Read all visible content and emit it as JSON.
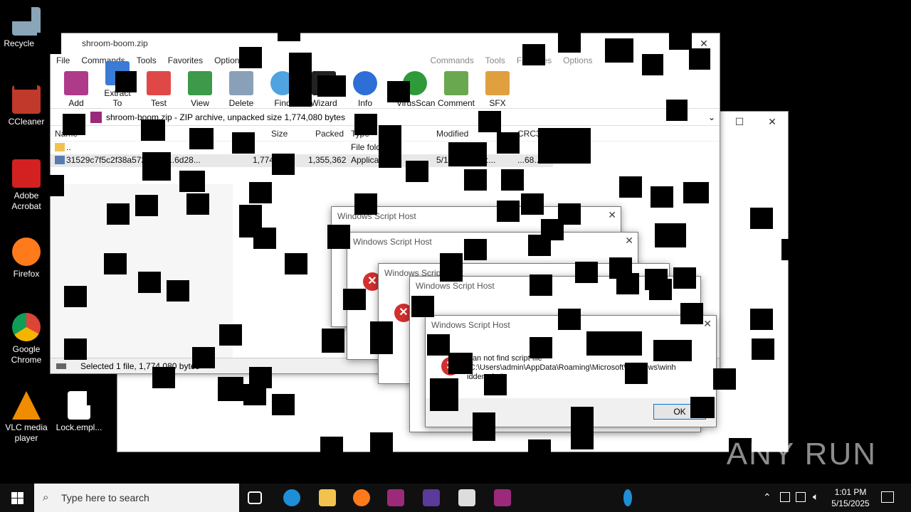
{
  "desktop_icons": [
    {
      "label": "Recycle Bin",
      "icon": "recycle-bin-icon"
    },
    {
      "label": "CCleaner",
      "icon": "ccleaner-icon"
    },
    {
      "label": "Adobe Acrobat",
      "icon": "acrobat-icon"
    },
    {
      "label": "Firefox",
      "icon": "firefox-icon"
    },
    {
      "label": "Google Chrome",
      "icon": "chrome-icon"
    },
    {
      "label": "VLC media player",
      "icon": "vlc-icon"
    },
    {
      "label": "Lock.empl...",
      "icon": "file-icon"
    }
  ],
  "winrar": {
    "title": "shroom-boom.zip",
    "menu": [
      "File",
      "Commands",
      "Tools",
      "Favorites",
      "Options"
    ],
    "toolbar": [
      "Add",
      "Extract To",
      "Test",
      "View",
      "Delete",
      "Find",
      "Wizard",
      "Info",
      "VirusScan",
      "Comment",
      "SFX"
    ],
    "path": "shroom-boom.zip - ZIP archive, unpacked size 1,774,080 bytes",
    "columns": [
      "Name",
      "Size",
      "Packed",
      "Type",
      "Modified",
      "CRC32"
    ],
    "rows": [
      {
        "name": "..",
        "size": "",
        "packed": "",
        "type": "File folder",
        "modified": "",
        "crc": ""
      },
      {
        "name": "31529c7f5c2f38a5722...b7...6d28...",
        "size": "1,774,080",
        "packed": "1,355,362",
        "type": "Application",
        "modified": "5/14/2025 12:...",
        "crc": "...68..."
      }
    ],
    "status": "Selected 1 file, 1,774,080 bytes"
  },
  "behind_window": {
    "menu": [
      "Commands",
      "Tools",
      "Favorites",
      "Options"
    ]
  },
  "dialogs": [
    {
      "title": "Windows Script Host"
    },
    {
      "title": "Windows Script Host"
    },
    {
      "title": "Windows Script Host"
    },
    {
      "title": "Windows Script Host"
    },
    {
      "title": "Windows Script Host",
      "message_line1": "Can not find script file",
      "message_line2": "\"C:\\Users\\admin\\AppData\\Roaming\\Microsoft\\Windows\\winh",
      "message_line3": "idden.vbs\".",
      "ok": "OK"
    }
  ],
  "taskbar": {
    "search_placeholder": "Type here to search",
    "time": "1:01 PM",
    "date": "5/15/2025"
  },
  "watermark": "ANY RUN"
}
